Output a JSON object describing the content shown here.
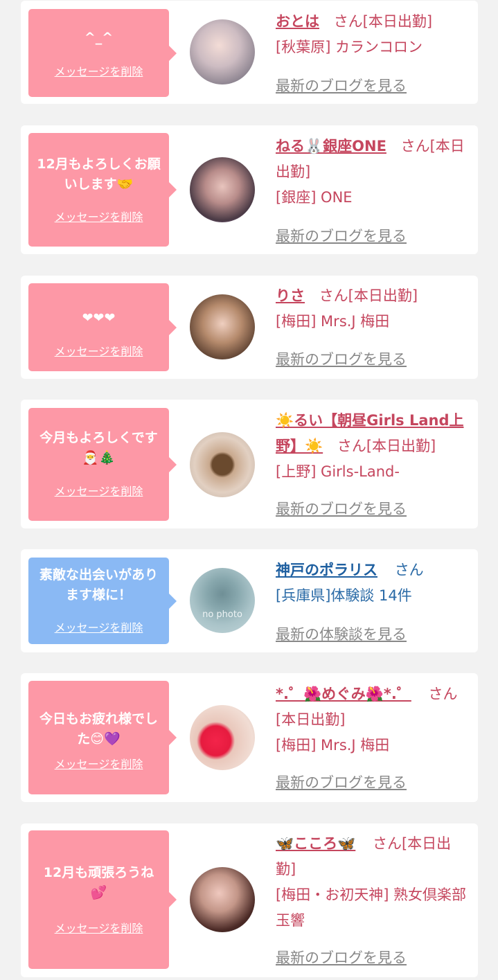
{
  "delete_label": "メッセージを削除",
  "cards": [
    {
      "message": "^_^",
      "name": "おとは",
      "suffix": "さん[本日出勤]",
      "shop": "[秋葉原] カランコロン",
      "link": "最新のブログを見る"
    },
    {
      "message": "12月もよろしくお願いします🤝",
      "name": "ねる🐰銀座ONE",
      "suffix": "さん[本日出勤]",
      "shop": "[銀座] ONE",
      "link": "最新のブログを見る"
    },
    {
      "message": "❤❤❤",
      "name": "りさ",
      "suffix": "さん[本日出勤]",
      "shop": "[梅田] Mrs.J 梅田",
      "link": "最新のブログを見る"
    },
    {
      "message": "今月もよろしくです🎅🎄",
      "name": "☀️るい【朝昼Girls Land上野】☀️",
      "suffix": "さん[本日出勤]",
      "shop": "[上野] Girls-Land-",
      "link": "最新のブログを見る"
    },
    {
      "message": "素敵な出会いがあります様に！",
      "name": "神戸のポラリス",
      "suffix": "さん",
      "shop": "[兵庫県]体験談 14件",
      "link": "最新の体験談を見る",
      "avatar_text": "no photo"
    },
    {
      "message": "今日もお疲れ様でした😊💜",
      "name": "*.゜🌺めぐみ🌺*.゜",
      "suffix": "さん[本日出勤]",
      "shop": "[梅田] Mrs.J 梅田",
      "link": "最新のブログを見る"
    },
    {
      "message": "12月も頑張ろうね💕",
      "name": "🦋こころ🦋",
      "suffix": "さん[本日出勤]",
      "shop": "[梅田・お初天神] 熟女倶楽部 玉響",
      "link": "最新のブログを見る"
    }
  ],
  "colors": {
    "pink_bubble": "#fd98a6",
    "blue_bubble": "#8ab9f4",
    "name_pink": "#c5465e",
    "name_blue": "#1e5fa0"
  }
}
